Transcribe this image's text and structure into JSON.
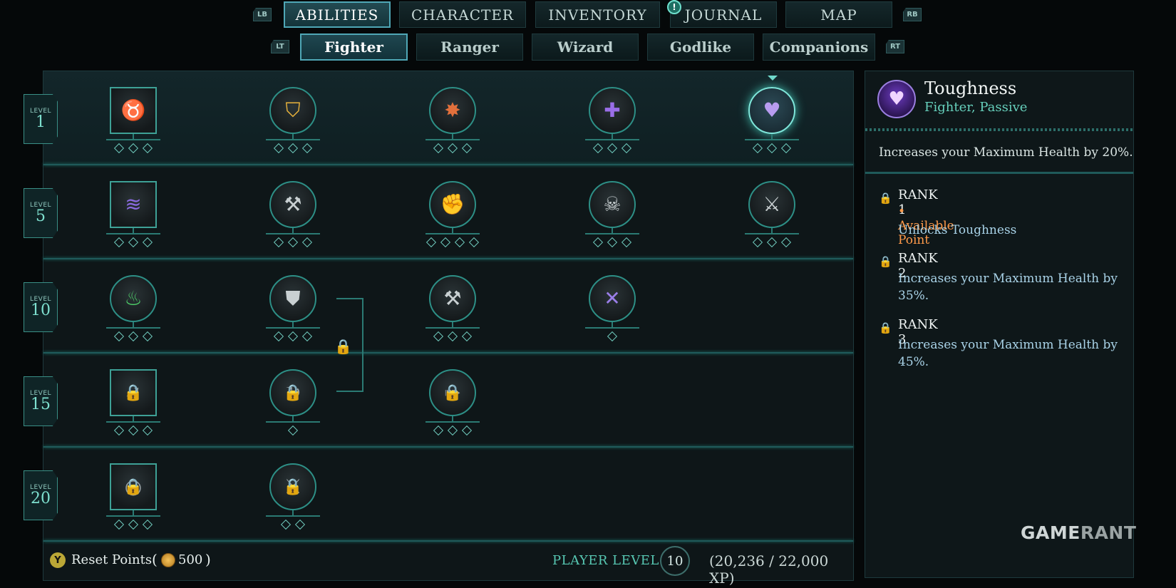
{
  "topnav": {
    "left_shoulder": "LB",
    "right_shoulder": "RB",
    "tabs": [
      "ABILITIES",
      "CHARACTER",
      "INVENTORY",
      "JOURNAL",
      "MAP"
    ],
    "notification_badge": "!"
  },
  "subnav": {
    "left_trigger": "LT",
    "right_trigger": "RT",
    "tabs": [
      "Fighter",
      "Ranger",
      "Wizard",
      "Godlike",
      "Companions"
    ]
  },
  "tree": {
    "level_label": "LEVEL",
    "levels": [
      "1",
      "5",
      "10",
      "15",
      "20"
    ],
    "nodes": [
      {
        "row": 0,
        "col": 0,
        "icon": "bull-head-icon",
        "glyph": "♉",
        "color": "#d8483a",
        "rank_pips": 3,
        "locked": false
      },
      {
        "row": 0,
        "col": 1,
        "icon": "glowing-shield-icon",
        "glyph": "⛉",
        "color": "#e9b33c",
        "rank_pips": 3,
        "locked": false
      },
      {
        "row": 0,
        "col": 2,
        "icon": "shield-burst-icon",
        "glyph": "✸",
        "color": "#e2703c",
        "rank_pips": 3,
        "locked": false
      },
      {
        "row": 0,
        "col": 3,
        "icon": "cross-cluster-icon",
        "glyph": "✚",
        "color": "#9a6ee8",
        "rank_pips": 3,
        "locked": false
      },
      {
        "row": 0,
        "col": 4,
        "icon": "heart-icon",
        "glyph": "♥",
        "color": "#b89cf0",
        "rank_pips": 3,
        "locked": false
      },
      {
        "row": 1,
        "col": 0,
        "icon": "claw-swipe-icon",
        "glyph": "≋",
        "color": "#8a6ae0",
        "rank_pips": 3,
        "locked": false
      },
      {
        "row": 1,
        "col": 1,
        "icon": "axe-icon",
        "glyph": "⚒",
        "color": "#c9d0d2",
        "rank_pips": 3,
        "locked": false
      },
      {
        "row": 1,
        "col": 2,
        "icon": "fist-icon",
        "glyph": "✊",
        "color": "#c9d0d2",
        "rank_pips": 4,
        "locked": false
      },
      {
        "row": 1,
        "col": 3,
        "icon": "skull-sword-icon",
        "glyph": "☠",
        "color": "#c9d0d2",
        "rank_pips": 3,
        "locked": false
      },
      {
        "row": 1,
        "col": 4,
        "icon": "double-axe-icon",
        "glyph": "⚔",
        "color": "#c9d0d2",
        "rank_pips": 3,
        "locked": false
      },
      {
        "row": 2,
        "col": 0,
        "icon": "green-flame-icon",
        "glyph": "♨",
        "color": "#4fd36a",
        "rank_pips": 3,
        "locked": false
      },
      {
        "row": 2,
        "col": 1,
        "icon": "shield-sword-icon",
        "glyph": "⛊",
        "color": "#c9d0d2",
        "rank_pips": 3,
        "locked": false
      },
      {
        "row": 2,
        "col": 2,
        "icon": "hammer-spin-icon",
        "glyph": "⚒",
        "color": "#c9d0d2",
        "rank_pips": 3,
        "locked": false
      },
      {
        "row": 2,
        "col": 3,
        "icon": "crossed-swords-icon",
        "glyph": "✕",
        "color": "#9a7ee8",
        "rank_pips": 1,
        "locked": false
      },
      {
        "row": 3,
        "col": 0,
        "icon": "dash-lock-icon",
        "glyph": "➶",
        "color": "#9aa3a6",
        "rank_pips": 3,
        "locked": true
      },
      {
        "row": 3,
        "col": 1,
        "icon": "spin-lock-icon",
        "glyph": "↻",
        "color": "#9aa3a6",
        "rank_pips": 1,
        "locked": true
      },
      {
        "row": 3,
        "col": 2,
        "icon": "charge-lock-icon",
        "glyph": "➠",
        "color": "#9aa3a6",
        "rank_pips": 3,
        "locked": true
      },
      {
        "row": 4,
        "col": 0,
        "icon": "whirl-lock-icon",
        "glyph": "◎",
        "color": "#9aa3a6",
        "rank_pips": 3,
        "locked": true
      },
      {
        "row": 4,
        "col": 1,
        "icon": "warrior-lock-icon",
        "glyph": "⚔",
        "color": "#9aa3a6",
        "rank_pips": 2,
        "locked": true
      }
    ]
  },
  "footer": {
    "button": "Y",
    "reset_label": "Reset Points",
    "open_paren": "(",
    "close_paren": ")",
    "reset_cost": "500",
    "player_level_label": "PLAYER LEVEL",
    "player_level": "10",
    "xp": "(20,236 / 22,000 XP)"
  },
  "detail": {
    "title": "Toughness",
    "subtitle": "Fighter, Passive",
    "description": "Increases your Maximum Health by 20%.",
    "ranks": [
      {
        "name": "RANK 1",
        "available": "• Available Point",
        "lines": [
          "Unlocks Toughness"
        ]
      },
      {
        "name": "RANK 2",
        "available": "",
        "lines": [
          "Increases your Maximum Health by",
          "35%."
        ]
      },
      {
        "name": "RANK 3",
        "available": "",
        "lines": [
          "Increases your Maximum Health by",
          "45%."
        ]
      }
    ],
    "watermark_a": "GAME",
    "watermark_b": "RANT"
  }
}
